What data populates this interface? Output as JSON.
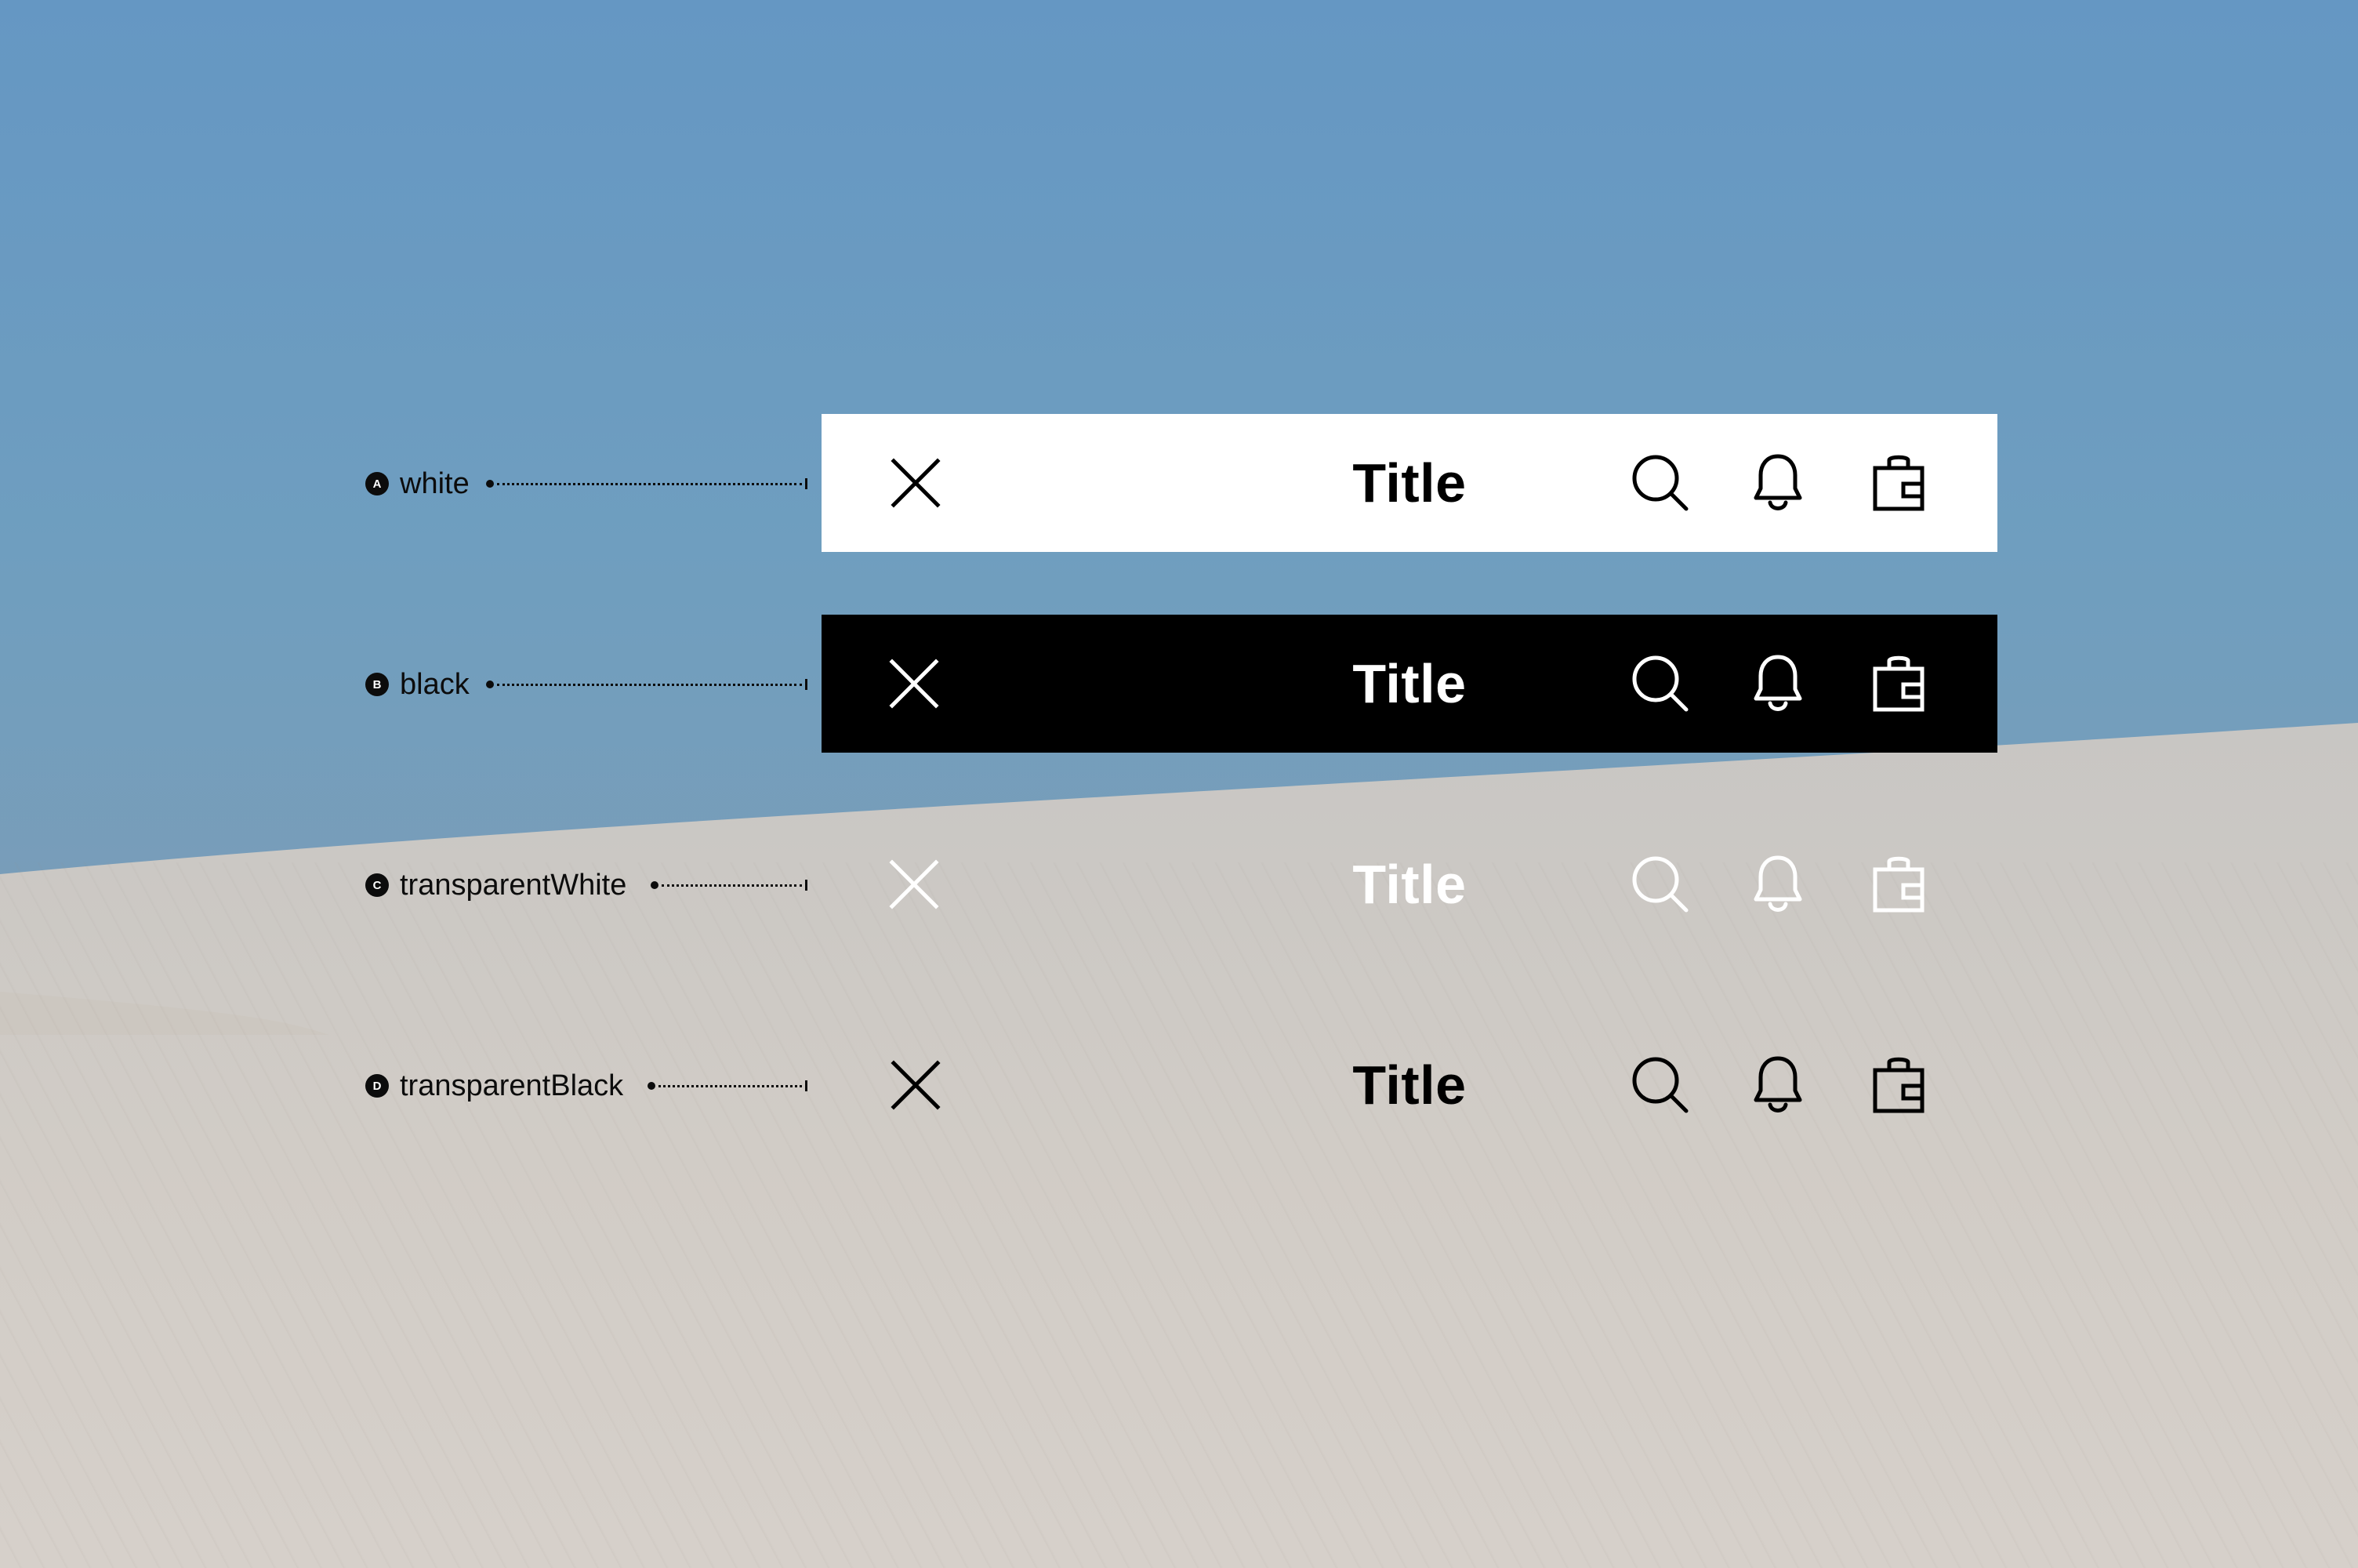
{
  "colors": {
    "bar_white": "#ffffff",
    "bar_black": "#000000",
    "sky": "#6a9bc3",
    "sand": "#d2ccc5"
  },
  "variants": [
    {
      "badge": "A",
      "label": "white",
      "title": "Title"
    },
    {
      "badge": "B",
      "label": "black",
      "title": "Title"
    },
    {
      "badge": "C",
      "label": "transparentWhite",
      "title": "Title"
    },
    {
      "badge": "D",
      "label": "transparentBlack",
      "title": "Title"
    }
  ],
  "icons": [
    "close-icon",
    "search-icon",
    "bell-icon",
    "shopping-bag-icon"
  ]
}
